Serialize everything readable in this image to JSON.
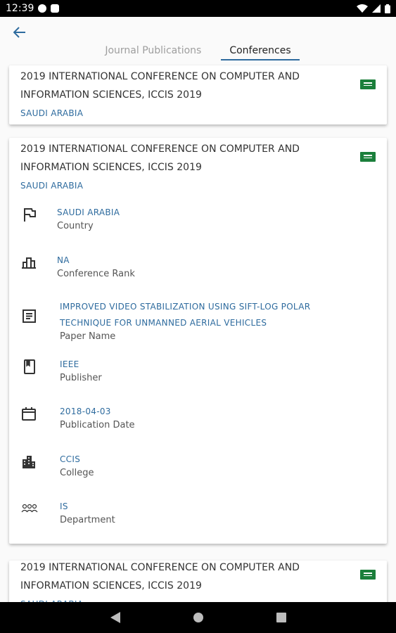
{
  "status_bar": {
    "time": "12:39"
  },
  "tabs": [
    {
      "label": "Journal Publications"
    },
    {
      "label": "Conferences"
    }
  ],
  "cards": [
    {
      "title": "2019 INTERNATIONAL CONFERENCE ON COMPUTER AND INFORMATION SCIENCES, ICCIS 2019",
      "country": "SAUDI ARABIA"
    },
    {
      "title": "2019 INTERNATIONAL CONFERENCE ON COMPUTER AND INFORMATION SCIENCES, ICCIS 2019",
      "country": "SAUDI ARABIA",
      "details": {
        "country": {
          "value": "SAUDI ARABIA",
          "label": "Country"
        },
        "rank": {
          "value": "NA",
          "label": "Conference Rank"
        },
        "paper": {
          "value": "IMPROVED VIDEO STABILIZATION USING SIFT-LOG POLAR TECHNIQUE FOR UNMANNED AERIAL VEHICLES",
          "label": "Paper Name"
        },
        "publisher": {
          "value": "IEEE",
          "label": "Publisher"
        },
        "date": {
          "value": "2018-04-03",
          "label": "Publication Date"
        },
        "college": {
          "value": "CCIS",
          "label": "College"
        },
        "department": {
          "value": "IS",
          "label": "Department"
        }
      }
    },
    {
      "title": "2019 INTERNATIONAL CONFERENCE ON COMPUTER AND INFORMATION SCIENCES, ICCIS 2019",
      "country": "SAUDI ARABIA"
    }
  ],
  "icons": {
    "back": "arrow-back-icon",
    "flag": "saudi-flag-icon",
    "country": "flag-outline-icon",
    "rank": "bar-chart-icon",
    "paper": "document-icon",
    "publisher": "book-icon",
    "date": "calendar-icon",
    "college": "building-icon",
    "department": "people-icon"
  },
  "colors": {
    "accent": "#2e6b9e",
    "flag_green": "#1b7f3b"
  }
}
